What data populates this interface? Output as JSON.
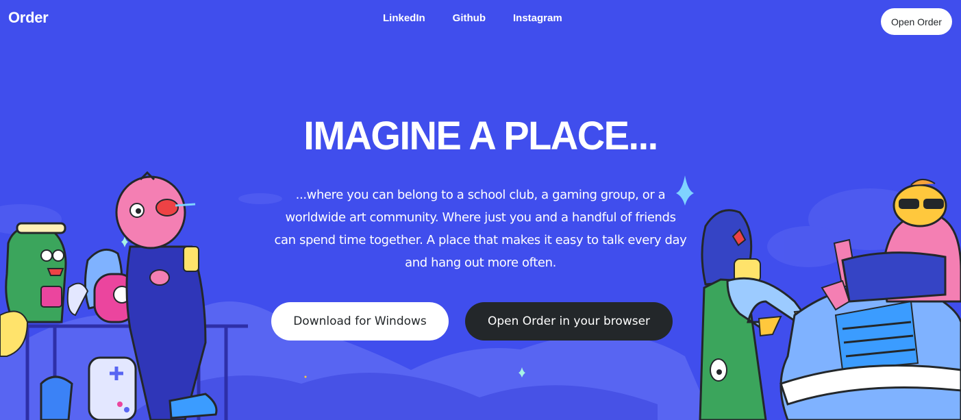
{
  "nav": {
    "brand": "Order",
    "links": [
      "LinkedIn",
      "Github",
      "Instagram"
    ],
    "open_button": "Open Order"
  },
  "hero": {
    "headline": "IMAGINE A PLACE...",
    "subtext": "...where you can belong to a school club, a gaming group, or a worldwide art community. Where just you and a handful of friends can spend time together. A place that makes it easy to talk every day and hang out more often.",
    "download_button": "Download for Windows",
    "browser_button": "Open Order in your browser"
  },
  "colors": {
    "background": "#404EED",
    "dark_button": "#23272A",
    "light_button": "#FFFFFF"
  },
  "icons": [
    "sparkle-icon",
    "gamepad-icon"
  ]
}
